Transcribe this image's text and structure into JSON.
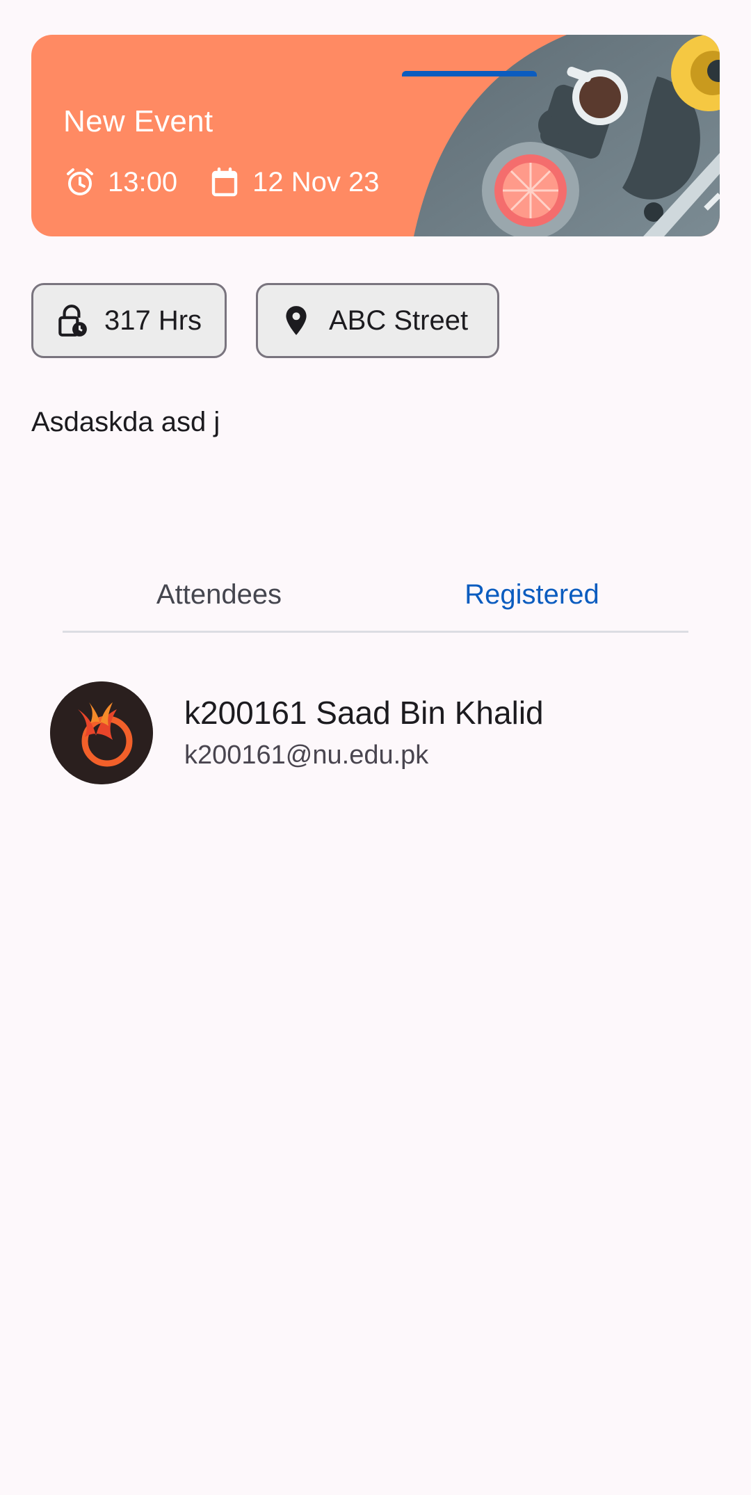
{
  "event": {
    "title": "New Event",
    "time": "13:00",
    "date": "12 Nov 23",
    "icons": {
      "time": "alarm-clock-icon",
      "date": "calendar-icon"
    }
  },
  "chips": {
    "hours": {
      "label": "317 Hrs",
      "icon": "lock-clock-icon"
    },
    "location": {
      "label": "ABC Street",
      "icon": "location-pin-icon"
    }
  },
  "description": "Asdaskda asd j",
  "tabs": {
    "attendees": "Attendees",
    "registered": "Registered",
    "selected": "registered"
  },
  "registered": [
    {
      "name": "k200161 Saad Bin Khalid",
      "email": "k200161@nu.edu.pk",
      "avatar": "phoenix-logo"
    }
  ],
  "colors": {
    "banner": "#ff8a63",
    "accent": "#0b5cbf",
    "background": "#fdf8fb",
    "chip": "#ececec"
  }
}
